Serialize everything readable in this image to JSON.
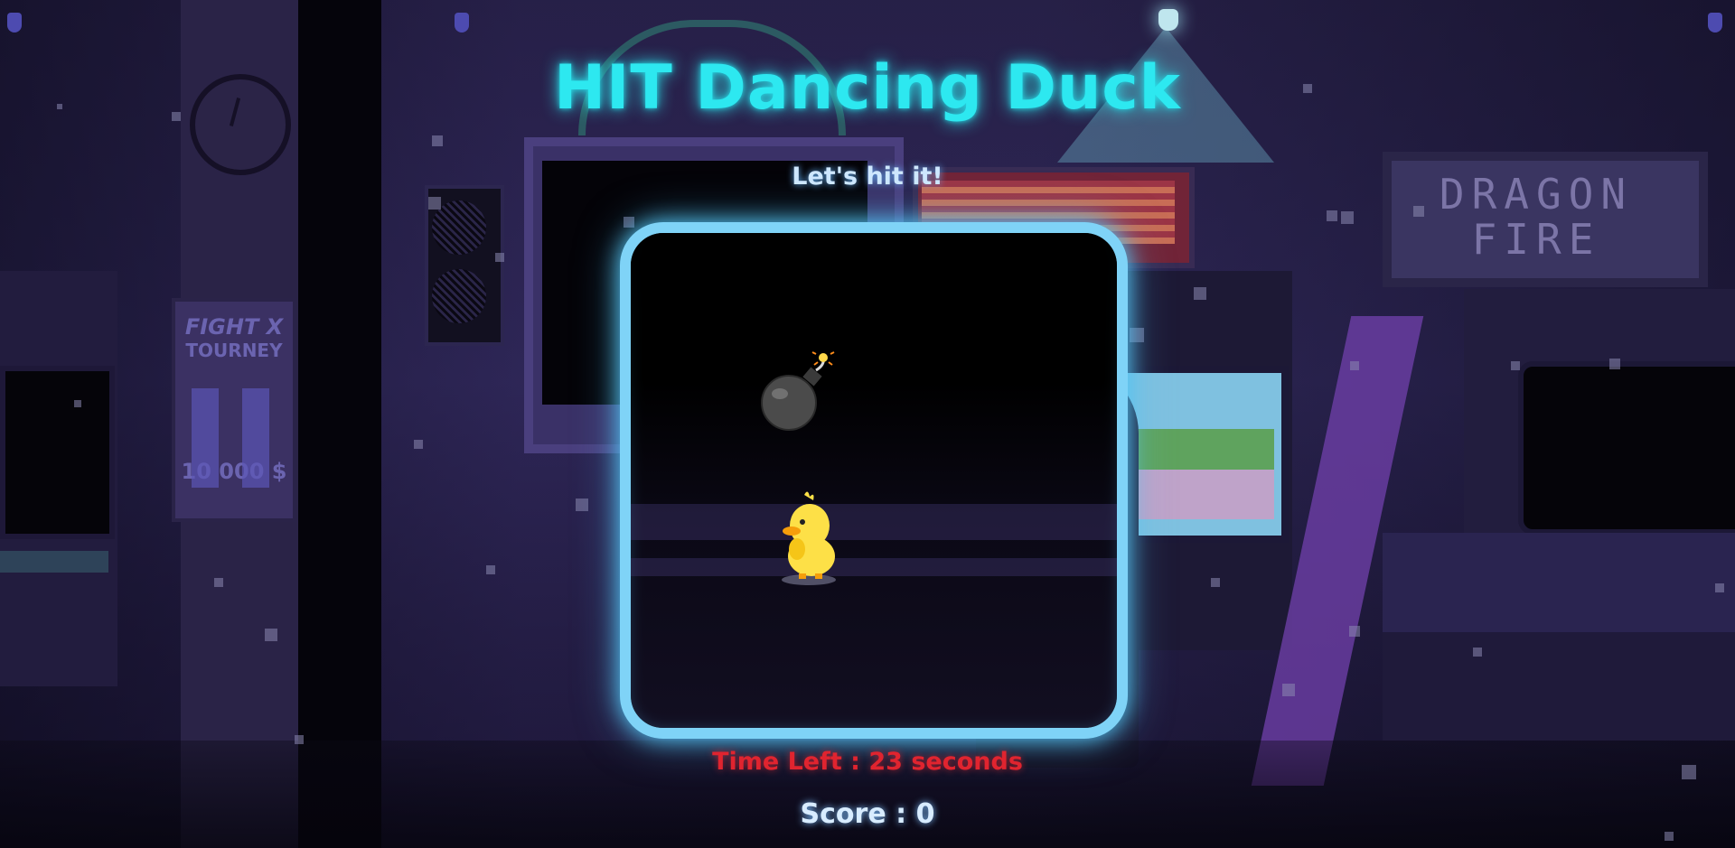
{
  "game": {
    "title": "HIT Dancing Duck",
    "subtitle": "Let's hit it!",
    "time_left_label": "Time Left : ",
    "time_left_value": "23",
    "time_left_unit": " seconds",
    "score_label": "Score : ",
    "score_value": "0"
  },
  "background": {
    "left_poster_title": "FIGHT X",
    "left_poster_subtitle": "TOURNEY",
    "left_poster_prize": "10 000 $",
    "right_sign": "DRAGON\nFIRE"
  },
  "sprites": {
    "bomb": "bomb-icon",
    "duck": "duck-icon"
  },
  "colors": {
    "title": "#2de8f0",
    "board_border": "#7fd3f7",
    "time_left": "#e0242f",
    "score": "#d8ecff",
    "duck_body": "#fde047",
    "bomb_body": "#4b4b4b"
  }
}
